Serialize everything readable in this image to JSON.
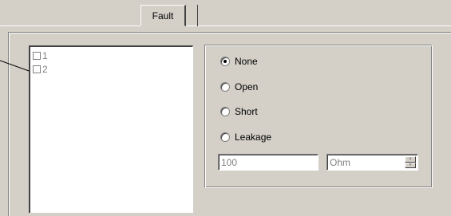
{
  "tabs": [
    {
      "label": "Fault"
    }
  ],
  "channel_list": {
    "items": [
      {
        "label": "1",
        "checked": false
      },
      {
        "label": "2",
        "checked": false
      }
    ]
  },
  "fault_type": {
    "selected": "None",
    "options": [
      {
        "label": "None"
      },
      {
        "label": "Open"
      },
      {
        "label": "Short"
      },
      {
        "label": "Leakage"
      }
    ]
  },
  "resistance": {
    "value": "100",
    "unit": "Ohm"
  },
  "icons": {
    "spin_up": "triangle-up",
    "spin_down": "triangle-down"
  }
}
